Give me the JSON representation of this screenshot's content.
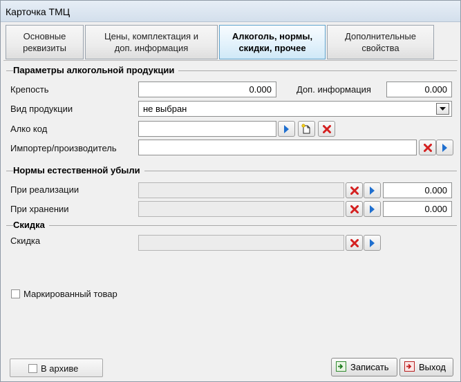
{
  "window": {
    "title": "Карточка ТМЦ"
  },
  "tabs": [
    {
      "label": "Основные\nреквизиты",
      "active": false
    },
    {
      "label": "Цены, комплектация и\nдоп.  информация",
      "active": false
    },
    {
      "label": "Алкоголь, нормы,\nскидки, прочее",
      "active": true
    },
    {
      "label": "Дополнительные\nсвойства",
      "active": false
    }
  ],
  "alcohol": {
    "group_title": "Параметры алкогольной продукции",
    "strength_label": "Крепость",
    "strength_value": "0.000",
    "extra_info_label": "Доп. информация",
    "extra_info_value": "0.000",
    "product_type_label": "Вид продукции",
    "product_type_value": "не выбран",
    "alco_code_label": "Алко код",
    "alco_code_value": "",
    "importer_label": "Импортер/производитель",
    "importer_value": ""
  },
  "norms": {
    "group_title": "Нормы естественной убыли",
    "sale_label": "При реализации",
    "sale_ref_value": "",
    "sale_value": "0.000",
    "storage_label": "При хранении",
    "storage_ref_value": "",
    "storage_value": "0.000"
  },
  "discount": {
    "group_title": "Скидка",
    "discount_label": "Скидка",
    "discount_value": ""
  },
  "marked_goods": {
    "label": "Маркированный товар",
    "checked": false
  },
  "archive": {
    "label": "В архиве",
    "checked": false
  },
  "footer": {
    "save_label": "Записать",
    "exit_label": "Выход"
  },
  "colors": {
    "active_tab_border": "#5fa3cc",
    "clear_icon": "#d42020",
    "arrow_icon": "#1f6fcf"
  }
}
